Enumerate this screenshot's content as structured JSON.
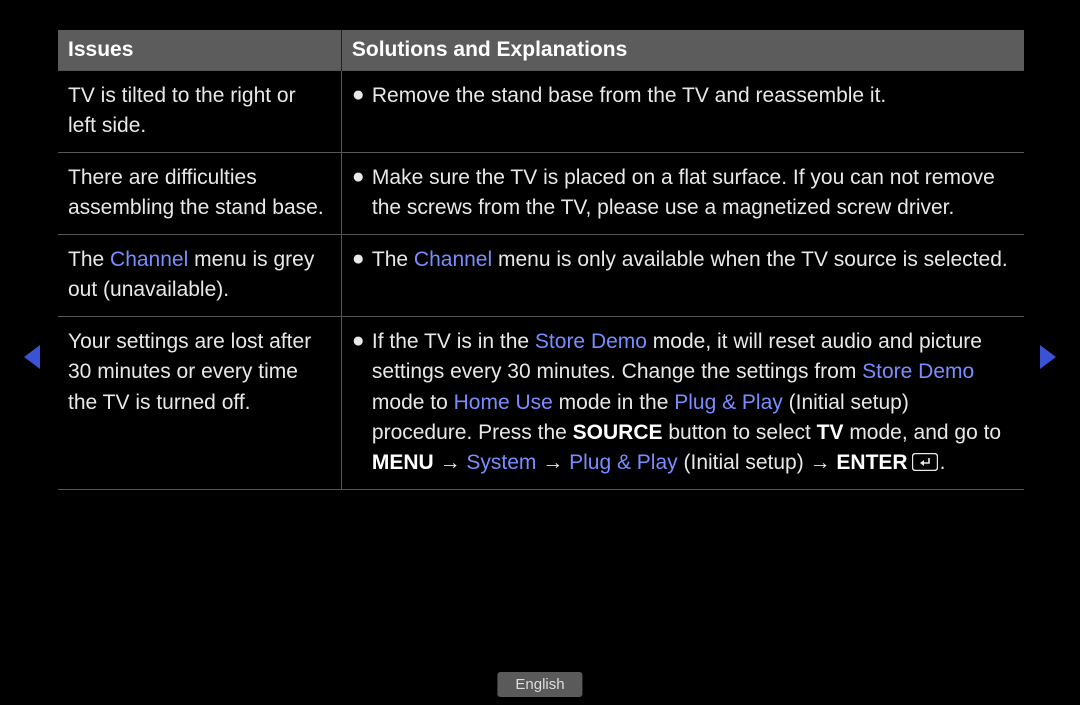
{
  "header": {
    "issues": "Issues",
    "solutions": "Solutions and Explanations"
  },
  "rows": {
    "r0": {
      "issue": "TV is tilted to the right or left side.",
      "sol": "Remove the stand base from the TV and reassemble it."
    },
    "r1": {
      "issue": "There are difficulties assembling the stand base.",
      "sol": "Make sure the TV is placed on a flat surface. If you can not remove the screws from the TV, please use a magnetized screw driver."
    },
    "r2": {
      "issue_pre": "The ",
      "issue_hl": "Channel",
      "issue_post": " menu is grey out (unavailable).",
      "sol_pre": "The ",
      "sol_hl": "Channel",
      "sol_post": " menu is only available when the TV source is selected."
    },
    "r3": {
      "issue": "Your settings are lost after 30 minutes or every time the TV is turned off.",
      "s1": "If the TV is in the ",
      "storeDemo": "Store Demo",
      "s2": " mode, it will reset audio and picture settings every 30 minutes. Change the settings from ",
      "s3": " mode to ",
      "homeUse": "Home Use",
      "s4": " mode in the ",
      "plugPlay": "Plug & Play",
      "s5": " (Initial setup) procedure. Press the ",
      "source": "SOURCE",
      "s6": " button to select ",
      "tv": "TV",
      "s7": " mode, and go to ",
      "menu": "MENU",
      "arrow": " → ",
      "system": "System",
      "s8": " (Initial setup) → ",
      "enter": "ENTER",
      "period": "."
    }
  },
  "footer": {
    "language": "English"
  }
}
